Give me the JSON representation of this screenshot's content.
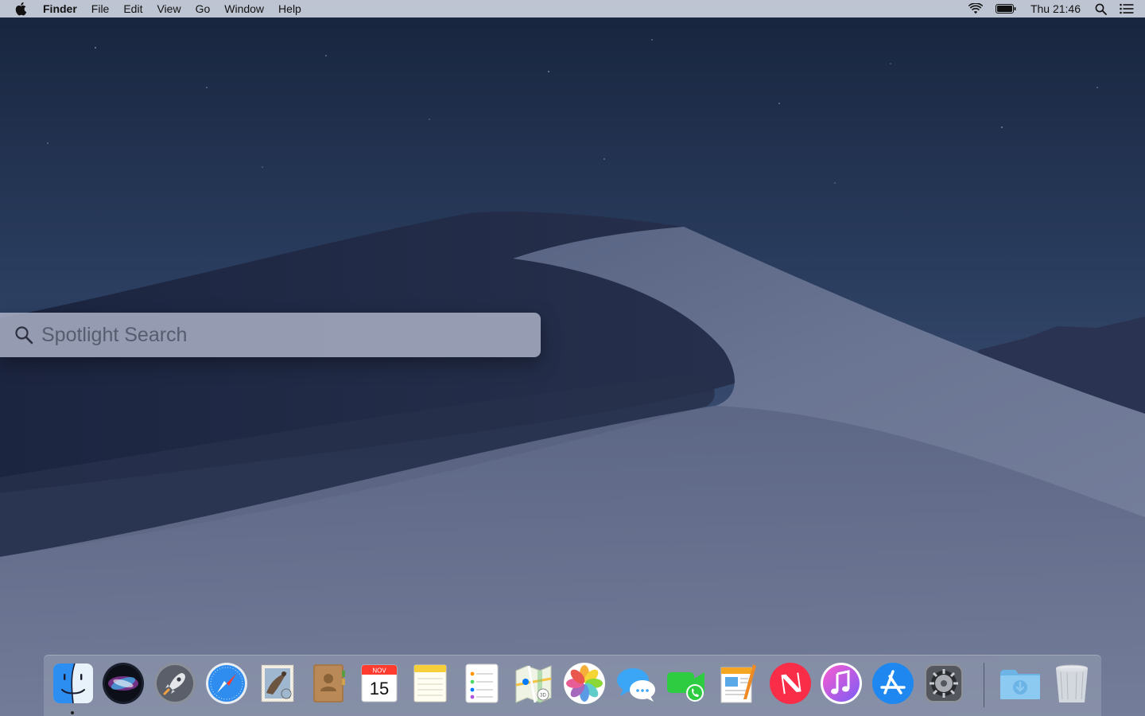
{
  "menubar": {
    "app_name": "Finder",
    "items": [
      "File",
      "Edit",
      "View",
      "Go",
      "Window",
      "Help"
    ],
    "clock": "Thu 21:46",
    "status_icons": [
      "wifi-icon",
      "battery-icon",
      "spotlight-icon",
      "notification-center-icon"
    ]
  },
  "spotlight": {
    "placeholder": "Spotlight Search",
    "value": ""
  },
  "dock": {
    "apps": [
      {
        "name": "Finder",
        "icon": "finder-icon",
        "running": true
      },
      {
        "name": "Siri",
        "icon": "siri-icon",
        "running": false
      },
      {
        "name": "Launchpad",
        "icon": "launchpad-icon",
        "running": false
      },
      {
        "name": "Safari",
        "icon": "safari-icon",
        "running": false
      },
      {
        "name": "Mail",
        "icon": "mail-icon",
        "running": false
      },
      {
        "name": "Contacts",
        "icon": "contacts-icon",
        "running": false
      },
      {
        "name": "Calendar",
        "icon": "calendar-icon",
        "running": false,
        "month": "NOV",
        "day": "15"
      },
      {
        "name": "Notes",
        "icon": "notes-icon",
        "running": false
      },
      {
        "name": "Reminders",
        "icon": "reminders-icon",
        "running": false
      },
      {
        "name": "Maps",
        "icon": "maps-icon",
        "running": false
      },
      {
        "name": "Photos",
        "icon": "photos-icon",
        "running": false
      },
      {
        "name": "Messages",
        "icon": "messages-icon",
        "running": false
      },
      {
        "name": "FaceTime",
        "icon": "facetime-icon",
        "running": false
      },
      {
        "name": "Pages",
        "icon": "pages-icon",
        "running": false
      },
      {
        "name": "News",
        "icon": "news-icon",
        "running": false
      },
      {
        "name": "iTunes",
        "icon": "itunes-icon",
        "running": false
      },
      {
        "name": "App Store",
        "icon": "app-store-icon",
        "running": false
      },
      {
        "name": "System Preferences",
        "icon": "system-preferences-icon",
        "running": false
      }
    ],
    "stacks": [
      {
        "name": "Downloads",
        "icon": "downloads-folder-icon"
      },
      {
        "name": "Trash",
        "icon": "trash-icon"
      }
    ]
  }
}
